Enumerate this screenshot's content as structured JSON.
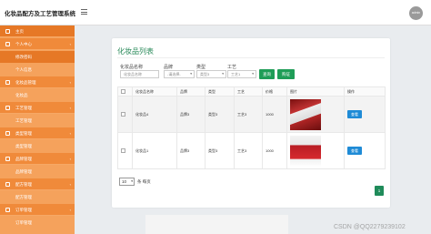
{
  "header": {
    "title": "化妆品配方及工艺管理系统",
    "avatar_text": "admin"
  },
  "sidebar": {
    "items": [
      {
        "label": "主页",
        "type": "parent",
        "active": true
      },
      {
        "label": "个人中心",
        "type": "parent"
      },
      {
        "label": "修改密码",
        "type": "child",
        "active": true
      },
      {
        "label": "个人信息",
        "type": "child"
      },
      {
        "label": "化妆品管理",
        "type": "parent"
      },
      {
        "label": "化妆品",
        "type": "child"
      },
      {
        "label": "工艺管理",
        "type": "parent"
      },
      {
        "label": "工艺管理",
        "type": "child"
      },
      {
        "label": "类型管理",
        "type": "parent"
      },
      {
        "label": "类型管理",
        "type": "child"
      },
      {
        "label": "品牌管理",
        "type": "parent"
      },
      {
        "label": "品牌管理",
        "type": "child"
      },
      {
        "label": "配方管理",
        "type": "parent"
      },
      {
        "label": "配方管理",
        "type": "child"
      },
      {
        "label": "订单管理",
        "type": "parent"
      },
      {
        "label": "订单管理",
        "type": "child"
      }
    ]
  },
  "card": {
    "title": "化妆品列表",
    "filters": {
      "name_label": "化妆品名称",
      "name_placeholder": "化妆品名称",
      "brand_label": "品牌",
      "brand_value": "-请选择-",
      "type_label": "类型",
      "type_value": "类型3",
      "craft_label": "工艺",
      "craft_value": "工艺1",
      "query_button": "查询",
      "reset_button": "购证"
    },
    "table": {
      "headers": [
        "",
        "化妆品名称",
        "品牌",
        "类型",
        "工艺",
        "价格",
        "图片",
        "操作"
      ],
      "rows": [
        {
          "name": "化妆品4",
          "brand": "品牌3",
          "type": "类型3",
          "craft": "工艺3",
          "price": "1000",
          "action": "查看"
        },
        {
          "name": "化妆品1",
          "brand": "品牌3",
          "type": "类型3",
          "craft": "工艺3",
          "price": "1000",
          "action": "查看"
        }
      ]
    },
    "pager": {
      "page_size": "10",
      "page_size_suffix": "条 每页",
      "current_page": "1"
    }
  },
  "watermark": "CSDN @QQ2279239102",
  "colors": {
    "sidebar": "#f5a25c",
    "sidebar_dark": "#f08a3a",
    "accent_green": "#1f9d57",
    "view_blue": "#1f8bd6"
  }
}
